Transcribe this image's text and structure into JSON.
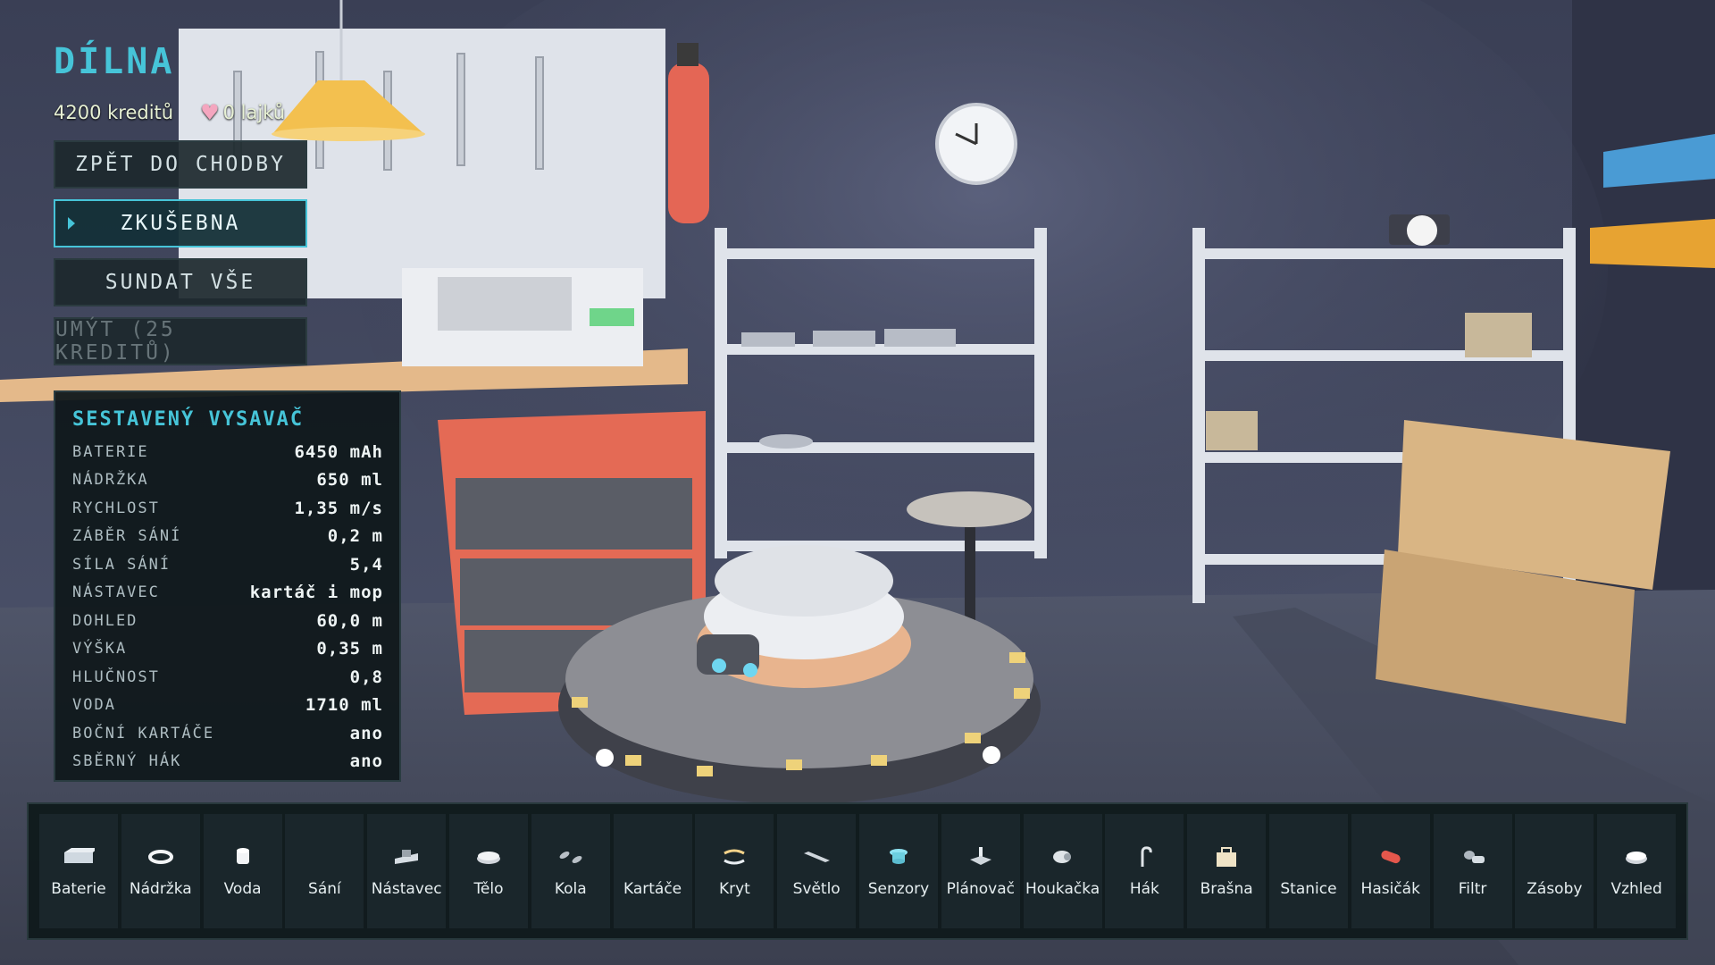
{
  "hud": {
    "title": "DÍLNA",
    "credits": "4200 kreditů",
    "likes": "0 lajků"
  },
  "menu": {
    "back": "ZPĚT DO CHODBY",
    "test": "ZKUŠEBNA",
    "remove_all": "SUNDAT VŠE",
    "wash": "UMÝT (25 KREDITŮ)"
  },
  "stats_panel": {
    "title": "SESTAVENÝ VYSAVAČ",
    "rows": [
      {
        "label": "BATERIE",
        "value": "6450 mAh"
      },
      {
        "label": "NÁDRŽKA",
        "value": "650 ml"
      },
      {
        "label": "RYCHLOST",
        "value": "1,35 m/s"
      },
      {
        "label": "ZÁBĚR SÁNÍ",
        "value": "0,2 m"
      },
      {
        "label": "SÍLA SÁNÍ",
        "value": "5,4"
      },
      {
        "label": "NÁSTAVEC",
        "value": "kartáč i mop"
      },
      {
        "label": "DOHLED",
        "value": "60,0 m"
      },
      {
        "label": "VÝŠKA",
        "value": "0,35 m"
      },
      {
        "label": "HLUČNOST",
        "value": "0,8"
      },
      {
        "label": "VODA",
        "value": "1710 ml"
      },
      {
        "label": "BOČNÍ KARTÁČE",
        "value": "ano"
      },
      {
        "label": "SBĚRNÝ HÁK",
        "value": "ano"
      }
    ]
  },
  "toolbar": {
    "items": [
      {
        "label": "Baterie",
        "icon": "battery-icon"
      },
      {
        "label": "Nádržka",
        "icon": "tank-ring-icon"
      },
      {
        "label": "Voda",
        "icon": "water-cylinder-icon"
      },
      {
        "label": "Sání",
        "icon": ""
      },
      {
        "label": "Nástavec",
        "icon": "attachment-icon"
      },
      {
        "label": "Tělo",
        "icon": "body-disc-icon"
      },
      {
        "label": "Kola",
        "icon": "wheels-icon"
      },
      {
        "label": "Kartáče",
        "icon": ""
      },
      {
        "label": "Kryt",
        "icon": "cover-icon"
      },
      {
        "label": "Světlo",
        "icon": "light-bar-icon"
      },
      {
        "label": "Senzory",
        "icon": "sensor-icon"
      },
      {
        "label": "Plánovač",
        "icon": "planner-icon"
      },
      {
        "label": "Houkačka",
        "icon": "horn-icon"
      },
      {
        "label": "Hák",
        "icon": "hook-icon"
      },
      {
        "label": "Brašna",
        "icon": "bag-icon"
      },
      {
        "label": "Stanice",
        "icon": ""
      },
      {
        "label": "Hasičák",
        "icon": "extinguisher-icon"
      },
      {
        "label": "Filtr",
        "icon": "filter-icon"
      },
      {
        "label": "Zásoby",
        "icon": ""
      },
      {
        "label": "Vzhled",
        "icon": "appearance-icon"
      }
    ]
  },
  "colors": {
    "accent": "#46c4d8",
    "panel_bg": "#10181b",
    "wall": "#3d4258"
  }
}
